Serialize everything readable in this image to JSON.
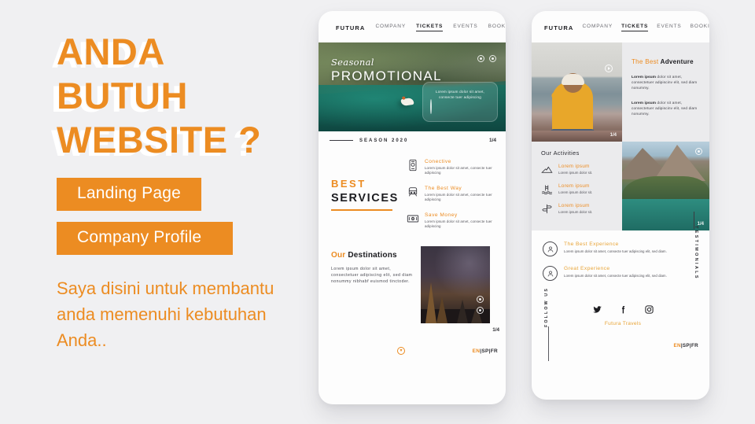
{
  "theme": {
    "background": "#f0f0f2",
    "accent_orange": "#ec8c22",
    "dark": "#1c1c20",
    "panel_gray": "#ebebed"
  },
  "promo": {
    "headline_lines": [
      "ANDA",
      "BUTUH",
      "WEBSITE ?"
    ],
    "buttons": [
      {
        "label": "Landing Page"
      },
      {
        "label": "Company Profile"
      }
    ],
    "subtext": "Saya disini untuk membantu anda memenuhi kebutuhan Anda.."
  },
  "mockup_left": {
    "nav": {
      "logo": "FUTURA",
      "items": [
        {
          "label": "COMPANY",
          "active": false
        },
        {
          "label": "TICKETS",
          "active": true
        },
        {
          "label": "EVENTS",
          "active": false
        },
        {
          "label": "BOOKING",
          "active": false
        }
      ]
    },
    "hero": {
      "script_title": "Seasonal",
      "main_title": "PROMOTIONAL",
      "glass_card_text": "Lorem ipsum dolor sit amet, consecte tuer adipiscing",
      "icons": [
        "circle-target-icon",
        "circle-dot-icon"
      ]
    },
    "season_bar": {
      "label": "SEASON 2020",
      "pagination": "1/4"
    },
    "services": {
      "eyebrow": "BEST",
      "title": "SERVICES",
      "items": [
        {
          "icon": "mobile-phone-icon",
          "title": "Conective",
          "text": "Lorem ipsum dolor sit amet, consecte tuer adipiscing"
        },
        {
          "icon": "train-icon",
          "title": "The Best Way",
          "text": "Lorem ipsum dolor sit amet, consecte tuer adipiscing"
        },
        {
          "icon": "money-bill-icon",
          "title": "Save Money",
          "text": "Lorem ipsum dolor sit amet, consecte tuer adipiscing"
        }
      ]
    },
    "destinations": {
      "title_accent": "Our",
      "title_rest": "Destinations",
      "text": "Lorem ipsum dolor sit amet, consectetuer adipiscing elit, sed diam nonummy nibhabf euismod tinctoder.",
      "image_alt": "night-sky-forest-photo",
      "pagination": "1/4"
    },
    "footer": {
      "scroll_icon": "chevron-down-circle-icon",
      "languages": "EN|SP|FR",
      "active_language": "EN"
    }
  },
  "mockup_right": {
    "nav": {
      "logo": "FUTURA",
      "items": [
        {
          "label": "COMPANY",
          "active": false
        },
        {
          "label": "TICKETS",
          "active": true
        },
        {
          "label": "EVENTS",
          "active": false
        },
        {
          "label": "BOOKING",
          "active": false
        }
      ]
    },
    "adventure": {
      "title_accent": "The Best",
      "title_rest": "Adventure",
      "paragraph_1_lead": "Lorem ipsum",
      "paragraph_1": " dolor sit amet, consectetuer adipiscinv elit, sed diam nonummy.",
      "paragraph_2_lead": "Lorem ipsum",
      "paragraph_2": " dolor sit amet, consectetuer adipiscinv elit, sed diam nonummy.",
      "photo_alt": "woman-sitting-on-rocks-photo",
      "photo_icon": "play-circle-icon",
      "pagination": "1/4"
    },
    "activities": {
      "title": "Our Activities",
      "items": [
        {
          "icon": "mountain-icon",
          "title": "Lorem ipsum",
          "text": "Lorem ipsum dolor sit."
        },
        {
          "icon": "pool-ladder-icon",
          "title": "Lorem ipsum",
          "text": "Lorem ipsum dolor sit."
        },
        {
          "icon": "signpost-icon",
          "title": "Lorem ipsum",
          "text": "Lorem ipsum dolor sit."
        }
      ],
      "photo_alt": "mountain-lake-photo",
      "photo_icon": "circle-target-icon",
      "pagination": "1/4"
    },
    "testimonials": {
      "vertical_label": "TESTIMONIALS",
      "items": [
        {
          "avatar": "user-circle-icon",
          "title": "The Best Experience",
          "text": "Lorem ipsum dolor sit amet, consecte tuer adipiscing elit, sed diam."
        },
        {
          "avatar": "user-circle-icon",
          "title": "Great Experience",
          "text": "Lorem ipsum dolor sit amet, consecte tuer adipiscing elit, sed diam."
        }
      ]
    },
    "footer": {
      "follow_label": "FOLLOW US",
      "socials": [
        "twitter-icon",
        "facebook-icon",
        "instagram-icon"
      ],
      "brand": "Futura Travels",
      "languages": "EN|SP|FR",
      "active_language": "EN"
    }
  }
}
